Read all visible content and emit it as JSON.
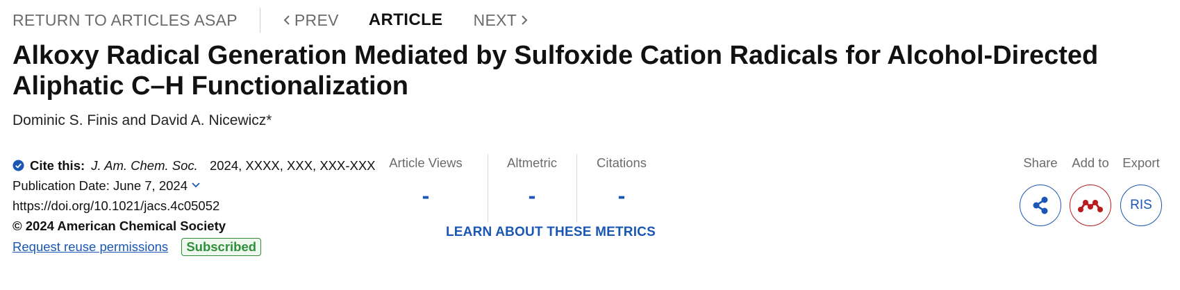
{
  "nav": {
    "return_label": "RETURN TO ARTICLES ASAP",
    "prev_label": "PREV",
    "current_label": "ARTICLE",
    "next_label": "NEXT"
  },
  "article": {
    "title": "Alkoxy Radical Generation Mediated by Sulfoxide Cation Radicals for Alcohol-Directed Aliphatic C–H Functionalization",
    "authors": "Dominic S. Finis and David A. Nicewicz*"
  },
  "citation": {
    "cite_label": "Cite this:",
    "journal": "J. Am. Chem. Soc.",
    "details": "2024, XXXX, XXX, XXX-XXX",
    "pub_date": "Publication Date: June 7, 2024",
    "doi": "https://doi.org/10.1021/jacs.4c05052",
    "copyright": "© 2024 American Chemical Society",
    "reuse_link": "Request reuse permissions",
    "access_badge": "Subscribed"
  },
  "metrics": {
    "items": [
      {
        "label": "Article Views",
        "value": "-"
      },
      {
        "label": "Altmetric",
        "value": "-"
      },
      {
        "label": "Citations",
        "value": "-"
      }
    ],
    "learn_link": "LEARN ABOUT THESE METRICS"
  },
  "actions": {
    "share_label": "Share",
    "addto_label": "Add to",
    "export_label": "Export",
    "export_button": "RIS",
    "share_icon": "share-icon",
    "mendeley_icon": "mendeley-icon"
  },
  "colors": {
    "link_blue": "#1a57b5",
    "mendeley_red": "#b91c1c",
    "subscribed_green": "#2f8f3a",
    "muted_gray": "#6b6b6b"
  }
}
